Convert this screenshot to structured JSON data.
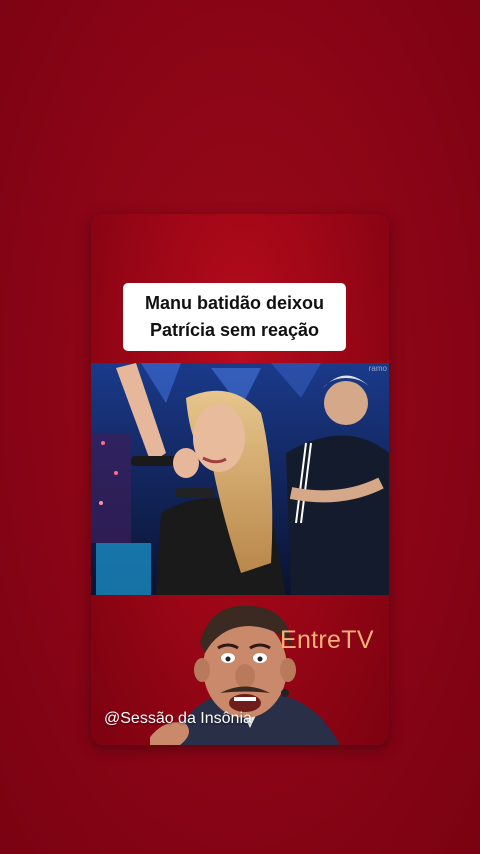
{
  "post": {
    "caption_line1": "Manu batidão deixou",
    "caption_line2": "Patrícia sem reação",
    "brand": "EntreTV",
    "handle": "@Sessão da Insônia",
    "video_corner_text": "ramo"
  },
  "colors": {
    "background": "#8a0516",
    "card": "#a8091a",
    "brand_text": "#f0b27a",
    "caption_bg": "#ffffff"
  },
  "icons": {
    "avatar": "caricature-presenter-avatar"
  }
}
